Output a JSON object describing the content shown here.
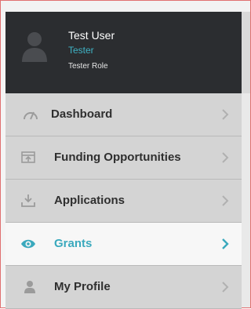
{
  "user": {
    "name": "Test User",
    "title": "Tester",
    "role": "Tester Role"
  },
  "menu": {
    "items": [
      {
        "label": "Dashboard",
        "icon": "dashboard-icon",
        "active": false
      },
      {
        "label": "Funding Opportunities",
        "icon": "funding-icon",
        "active": false
      },
      {
        "label": "Applications",
        "icon": "download-icon",
        "active": false
      },
      {
        "label": "Grants",
        "icon": "eye-icon",
        "active": true
      },
      {
        "label": "My Profile",
        "icon": "user-icon",
        "active": false
      }
    ]
  },
  "colors": {
    "profile_bg": "#2b2d30",
    "accent": "#3aa9bd",
    "menu_bg": "#d4d4d4",
    "active_bg": "#f7f7f7"
  }
}
